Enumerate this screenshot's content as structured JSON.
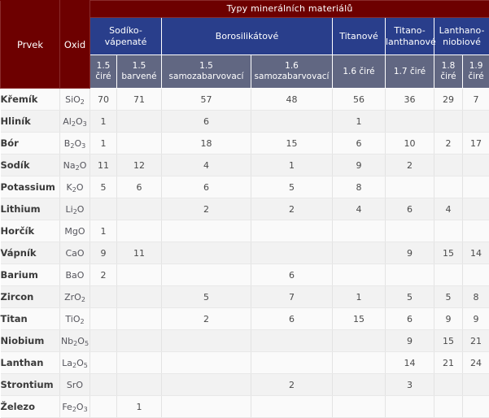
{
  "table": {
    "title": "Typy minerálních materiálů",
    "corner_headers": [
      {
        "label": "Prvek",
        "name": "column-header-element"
      },
      {
        "label": "Oxid",
        "name": "column-header-oxide"
      }
    ],
    "groups": [
      {
        "label": "Sodíko-\nvápenaté",
        "span": 2
      },
      {
        "label": "Borosilikátové",
        "span": 2
      },
      {
        "label": "Titanové",
        "span": 1
      },
      {
        "label": "Titano-\nlanthanové",
        "span": 1
      },
      {
        "label": "Lanthano-\nniobiové",
        "span": 2
      }
    ],
    "subheaders": [
      "1.5\nčiré",
      "1.5\nbarvené",
      "1.5\nsamozabarvovací",
      "1.6\nsamozabarvovací",
      "1.6 čiré",
      "1.7 čiré",
      "1.8\nčiré",
      "1.9\nčiré"
    ],
    "rows": [
      {
        "element": "Křemík",
        "oxide": "SiO2",
        "values": [
          "70",
          "71",
          "57",
          "48",
          "56",
          "36",
          "29",
          "7"
        ]
      },
      {
        "element": "Hliník",
        "oxide": "Al2O3",
        "values": [
          "1",
          "",
          "6",
          "",
          "1",
          "",
          "",
          ""
        ]
      },
      {
        "element": "Bór",
        "oxide": "B2O3",
        "values": [
          "1",
          "",
          "18",
          "15",
          "6",
          "10",
          "2",
          "17"
        ]
      },
      {
        "element": "Sodík",
        "oxide": "Na2O",
        "values": [
          "11",
          "12",
          "4",
          "1",
          "9",
          "2",
          "",
          ""
        ]
      },
      {
        "element": "Potassium",
        "oxide": "K2O",
        "values": [
          "5",
          "6",
          "6",
          "5",
          "8",
          "",
          "",
          ""
        ]
      },
      {
        "element": "Lithium",
        "oxide": "Li2O",
        "values": [
          "",
          "",
          "2",
          "2",
          "4",
          "6",
          "4",
          ""
        ]
      },
      {
        "element": "Horčík",
        "oxide": "MgO",
        "values": [
          "1",
          "",
          "",
          "",
          "",
          "",
          "",
          ""
        ]
      },
      {
        "element": "Vápník",
        "oxide": "CaO",
        "values": [
          "9",
          "11",
          "",
          "",
          "",
          "9",
          "15",
          "14"
        ]
      },
      {
        "element": "Barium",
        "oxide": "BaO",
        "values": [
          "2",
          "",
          "",
          "6",
          "",
          "",
          "",
          ""
        ]
      },
      {
        "element": "Zircon",
        "oxide": "ZrO2",
        "values": [
          "",
          "",
          "5",
          "7",
          "1",
          "5",
          "5",
          "8"
        ]
      },
      {
        "element": "Titan",
        "oxide": "TiO2",
        "values": [
          "",
          "",
          "2",
          "6",
          "15",
          "6",
          "9",
          "9"
        ]
      },
      {
        "element": "Niobium",
        "oxide": "Nb2O5",
        "values": [
          "",
          "",
          "",
          "",
          "",
          "9",
          "15",
          "21"
        ]
      },
      {
        "element": "Lanthan",
        "oxide": "La2O5",
        "values": [
          "",
          "",
          "",
          "",
          "",
          "14",
          "21",
          "24"
        ]
      },
      {
        "element": "Strontium",
        "oxide": "SrO",
        "values": [
          "",
          "",
          "",
          "2",
          "",
          "3",
          "",
          ""
        ]
      },
      {
        "element": "Železo",
        "oxide": "Fe2O3",
        "values": [
          "",
          "1",
          "",
          "",
          "",
          "",
          "",
          ""
        ]
      }
    ]
  },
  "colors": {
    "header_dark_red": "#6d0000",
    "header_blue": "#293e8b",
    "header_subgray": "#616782",
    "row_light": "#fafafa",
    "row_alt": "#f2f2f2",
    "text_body": "#4a4a4a"
  }
}
